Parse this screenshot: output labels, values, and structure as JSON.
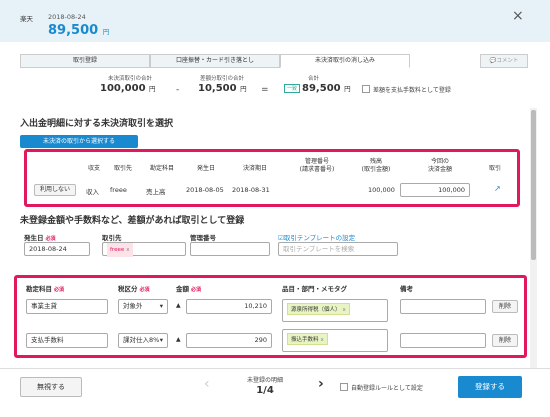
{
  "header": {
    "bank": "楽天",
    "date": "2018-08-24",
    "amount": "89,500",
    "yen": "円",
    "close": "×"
  },
  "tabs": [
    {
      "label": "取引登録"
    },
    {
      "label": "口座振替・カード引き落とし"
    },
    {
      "label": "未決済取引の消し込み"
    },
    {
      "label": "💬コメント"
    }
  ],
  "summary": {
    "unsettled_label": "未決済取引の合計",
    "unsettled_value": "100,000",
    "diff_label": "差額分取引の合計",
    "diff_value": "10,500",
    "total_label": "合計",
    "total_value": "89,500",
    "total_badge": "一致",
    "yen": "円",
    "minus": "-",
    "equals": "=",
    "register_diff_fee": "差額を支払手数料として登録"
  },
  "section1": {
    "title": "入出金明細に対する未決済取引を選択",
    "select_button": "未決済の取引から選択する",
    "columns": [
      "収支",
      "取引先",
      "勘定科目",
      "発生日",
      "決済期日",
      "管理番号\n(請求書番号)",
      "残高\n(取引金額)",
      "今回の\n決済金額",
      "取引"
    ],
    "row": {
      "action": "利用しない",
      "type": "収入",
      "partner": "freee",
      "account": "売上高",
      "date": "2018-08-05",
      "due": "2018-08-31",
      "mgmt": "",
      "balance": "100,000",
      "payment": "100,000"
    }
  },
  "section2": {
    "title": "未登録金額や手数料など、差額があれば取引として登録",
    "date_label": "発生日",
    "required": "必須",
    "date_value": "2018-08-24",
    "partner_label": "取引先",
    "partner_tag": "freee",
    "mgmt_label": "管理番号",
    "template_link": "☑取引テンプレートの設定",
    "template_placeholder": "取引テンプレートを検索",
    "columns": {
      "account": "勘定科目",
      "tax": "税区分",
      "amount": "金額",
      "item": "品目・部門・メモタグ",
      "note": "備考"
    },
    "rows": [
      {
        "account": "事業主貸",
        "tax": "対象外",
        "amount": "10,210",
        "tag": "源泉所得税（個人）",
        "delete": "削除"
      },
      {
        "account": "支払手数料",
        "tax": "課対仕入8%",
        "amount": "290",
        "tag": "振込手数料",
        "delete": "削除"
      }
    ]
  },
  "footer": {
    "skip": "無視する",
    "pager_label": "未登録の明細",
    "pager_value": "1/4",
    "auto_rule": "自動登録ルールとして設定",
    "register": "登録する"
  },
  "colors": {
    "accent": "#1a8ad0",
    "highlight": "#e1185d",
    "header_bg": "#e6f2f8"
  }
}
